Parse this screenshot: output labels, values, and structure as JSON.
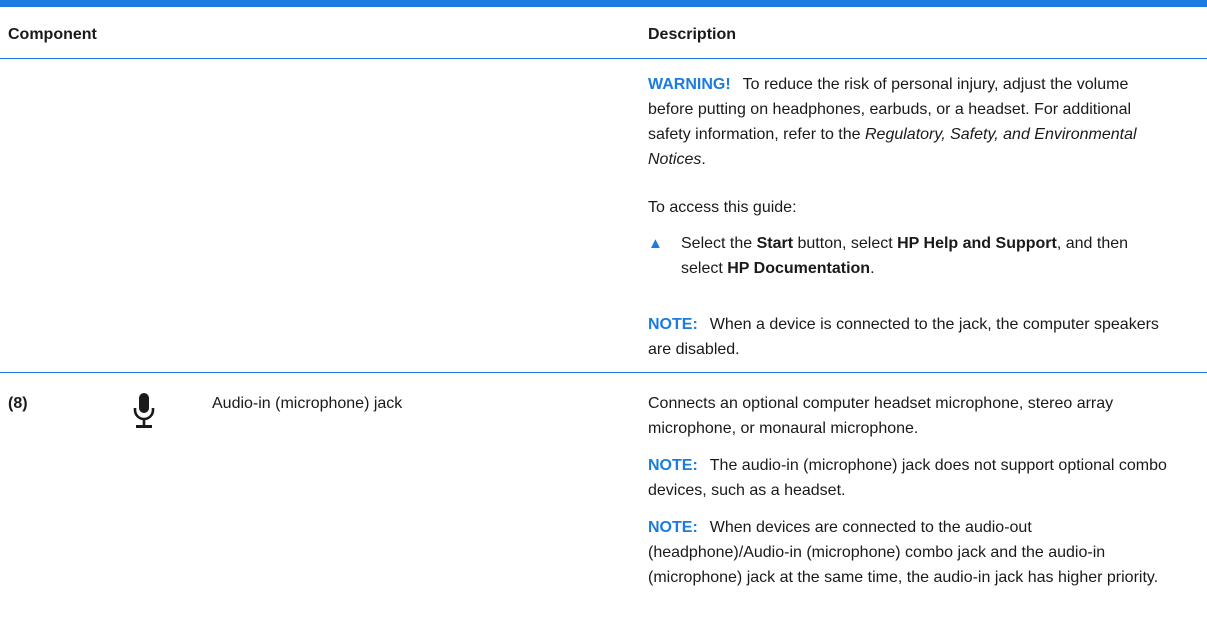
{
  "table": {
    "header_component": "Component",
    "header_description": "Description"
  },
  "row1": {
    "warning_label": "WARNING!",
    "warning_text_1": "To reduce the risk of personal injury, adjust the volume before putting on headphones, earbuds, or a headset. For additional safety information, refer to the ",
    "warning_italic": "Regulatory, Safety, and Environmental Notices",
    "warning_text_2": ".",
    "access_text": "To access this guide:",
    "bullet_glyph": "▲",
    "step_1": "Select the ",
    "step_start": "Start",
    "step_2": " button, select ",
    "step_help": "HP Help and Support",
    "step_3": ", and then select ",
    "step_docs": "HP Documentation",
    "step_4": ".",
    "note_label": "NOTE:",
    "note_text": "When a device is connected to the jack, the computer speakers are disabled."
  },
  "row2": {
    "number": "(8)",
    "icon": "microphone-icon",
    "component": "Audio-in (microphone) jack",
    "description": "Connects an optional computer headset microphone, stereo array microphone, or monaural microphone.",
    "note1_label": "NOTE:",
    "note1_text": "The audio-in (microphone) jack does not support optional combo devices, such as a headset.",
    "note2_label": "NOTE:",
    "note2_text": "When devices are connected to the audio-out (headphone)/Audio-in (microphone) combo jack and the audio-in (microphone) jack at the same time, the audio-in jack has higher priority."
  },
  "colors": {
    "accent": "#1c7be0",
    "text": "#1a1a1a"
  }
}
